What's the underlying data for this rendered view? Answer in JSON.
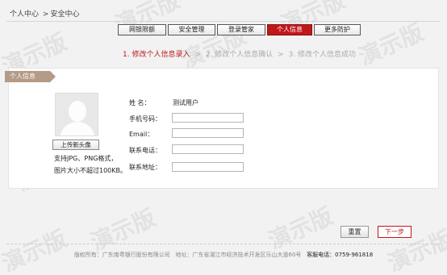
{
  "breadcrumb": {
    "home": "个人中心",
    "separator": ">",
    "current": "安全中心"
  },
  "tabs": [
    {
      "label": "网银限额"
    },
    {
      "label": "安全管理"
    },
    {
      "label": "登录管家"
    },
    {
      "label": "个人信息"
    },
    {
      "label": "更多防护"
    }
  ],
  "steps": {
    "step1": "1. 修改个人信息录入",
    "arrow": ">",
    "step2": "2. 修改个人信息确认",
    "step3": "3. 修改个人信息成功"
  },
  "panel": {
    "title": "个人信息",
    "upload_button": "上传新头像",
    "upload_hint_1": "支持JPG、PNG格式，",
    "upload_hint_2": "图片大小不超过100KB。"
  },
  "form": {
    "name_label": "姓    名：",
    "name_value": "测试用户",
    "phone_label": "手机号码：",
    "email_label": "Email：",
    "tel_label": "联系电话：",
    "address_label": "联系地址："
  },
  "actions": {
    "reset": "重置",
    "next": "下一步"
  },
  "footer": {
    "copyright": "版权所有：广东南粤银行股份有限公司",
    "address": "地址：广东省湛江市经济技术开发区乐山大道60号",
    "hotline_label": "客服电话：",
    "hotline": "0759-961818"
  },
  "watermark": "演示版",
  "colors": {
    "accent": "#c0171b",
    "panel_tag": "#b59a86"
  }
}
